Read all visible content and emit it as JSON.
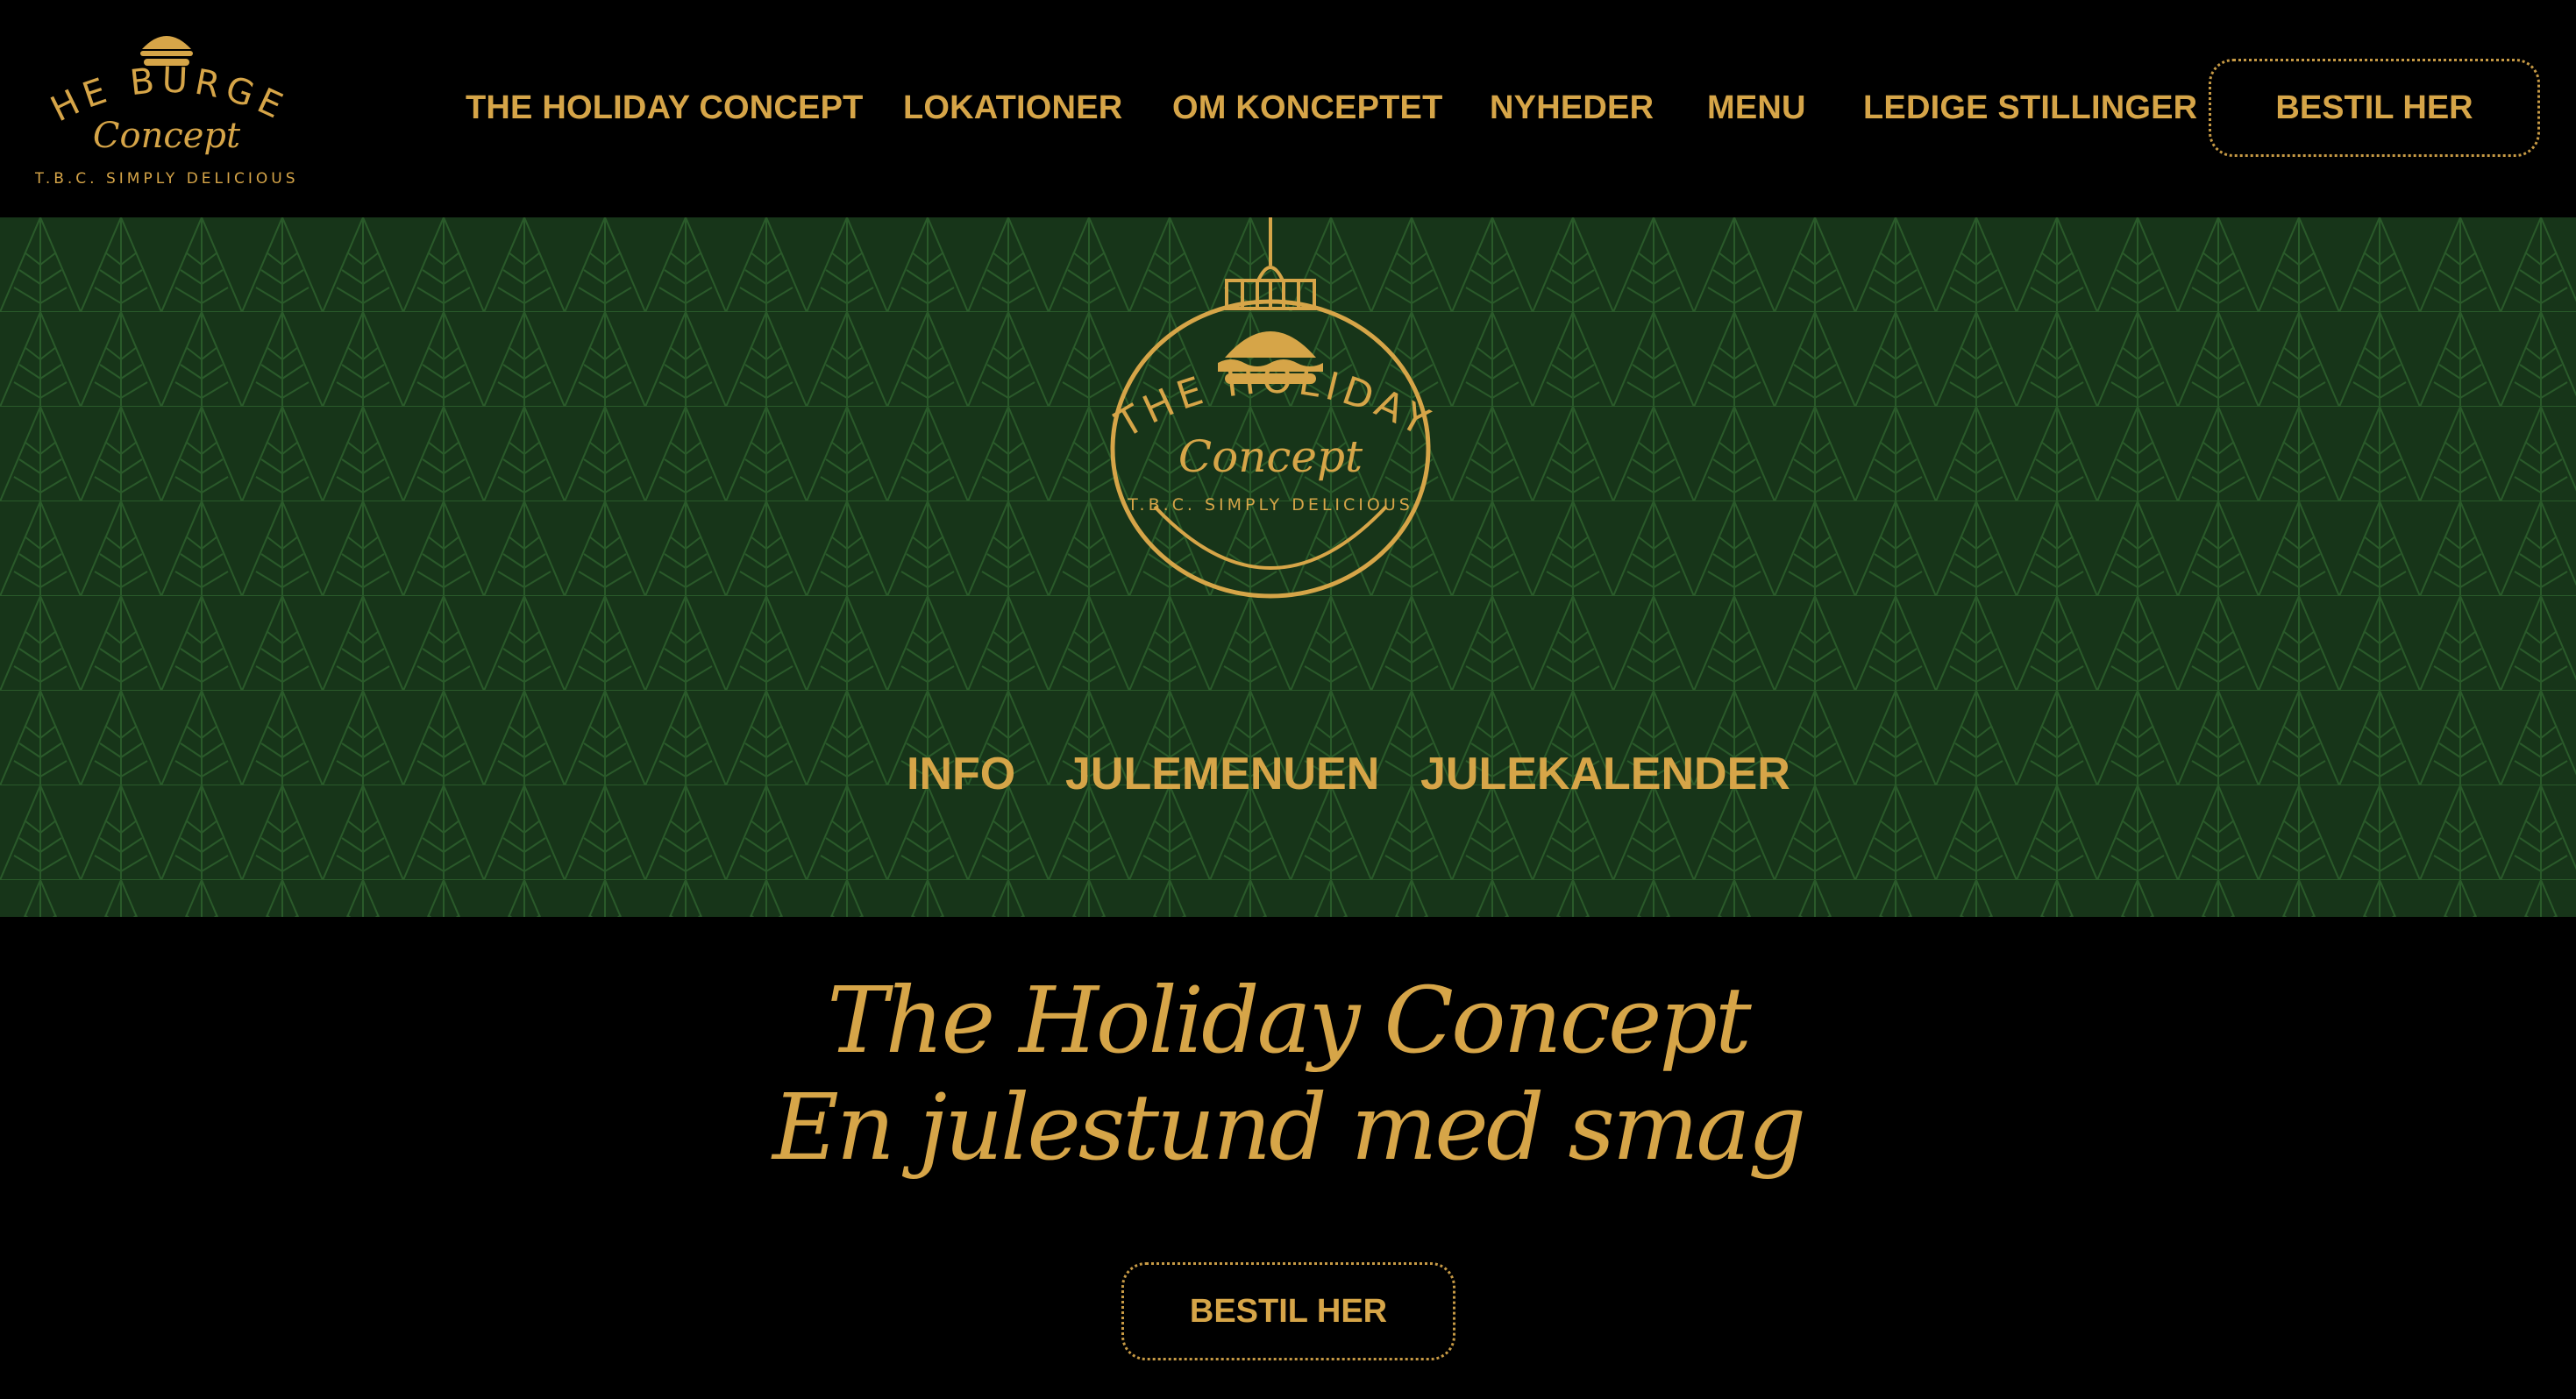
{
  "brand": {
    "logo_line1": "THE BURGER",
    "logo_line2": "Concept",
    "logo_line3": "T.B.C. SIMPLY DELICIOUS"
  },
  "nav": {
    "items": [
      {
        "label": "THE HOLIDAY CONCEPT"
      },
      {
        "label": "LOKATIONER"
      },
      {
        "label": "OM KONCEPTET"
      },
      {
        "label": "NYHEDER"
      },
      {
        "label": "MENU"
      },
      {
        "label": "LEDIGE STILLINGER"
      }
    ],
    "order_label": "BESTIL HER"
  },
  "hero": {
    "ornament_line1": "THE HOLIDAY",
    "ornament_line2": "Concept",
    "ornament_line3": "T.B.C. SIMPLY DELICIOUS",
    "subnav": [
      {
        "label": "INFO"
      },
      {
        "label": "JULEMENUEN"
      },
      {
        "label": "JULEKALENDER"
      }
    ]
  },
  "main": {
    "title_line1": "The Holiday Concept",
    "title_line2": "En julestund med smag",
    "order_label": "BESTIL HER"
  },
  "colors": {
    "gold": "#d6a548",
    "hero_green": "#173519",
    "pattern_green": "#2a5a2a",
    "background": "#000000"
  }
}
